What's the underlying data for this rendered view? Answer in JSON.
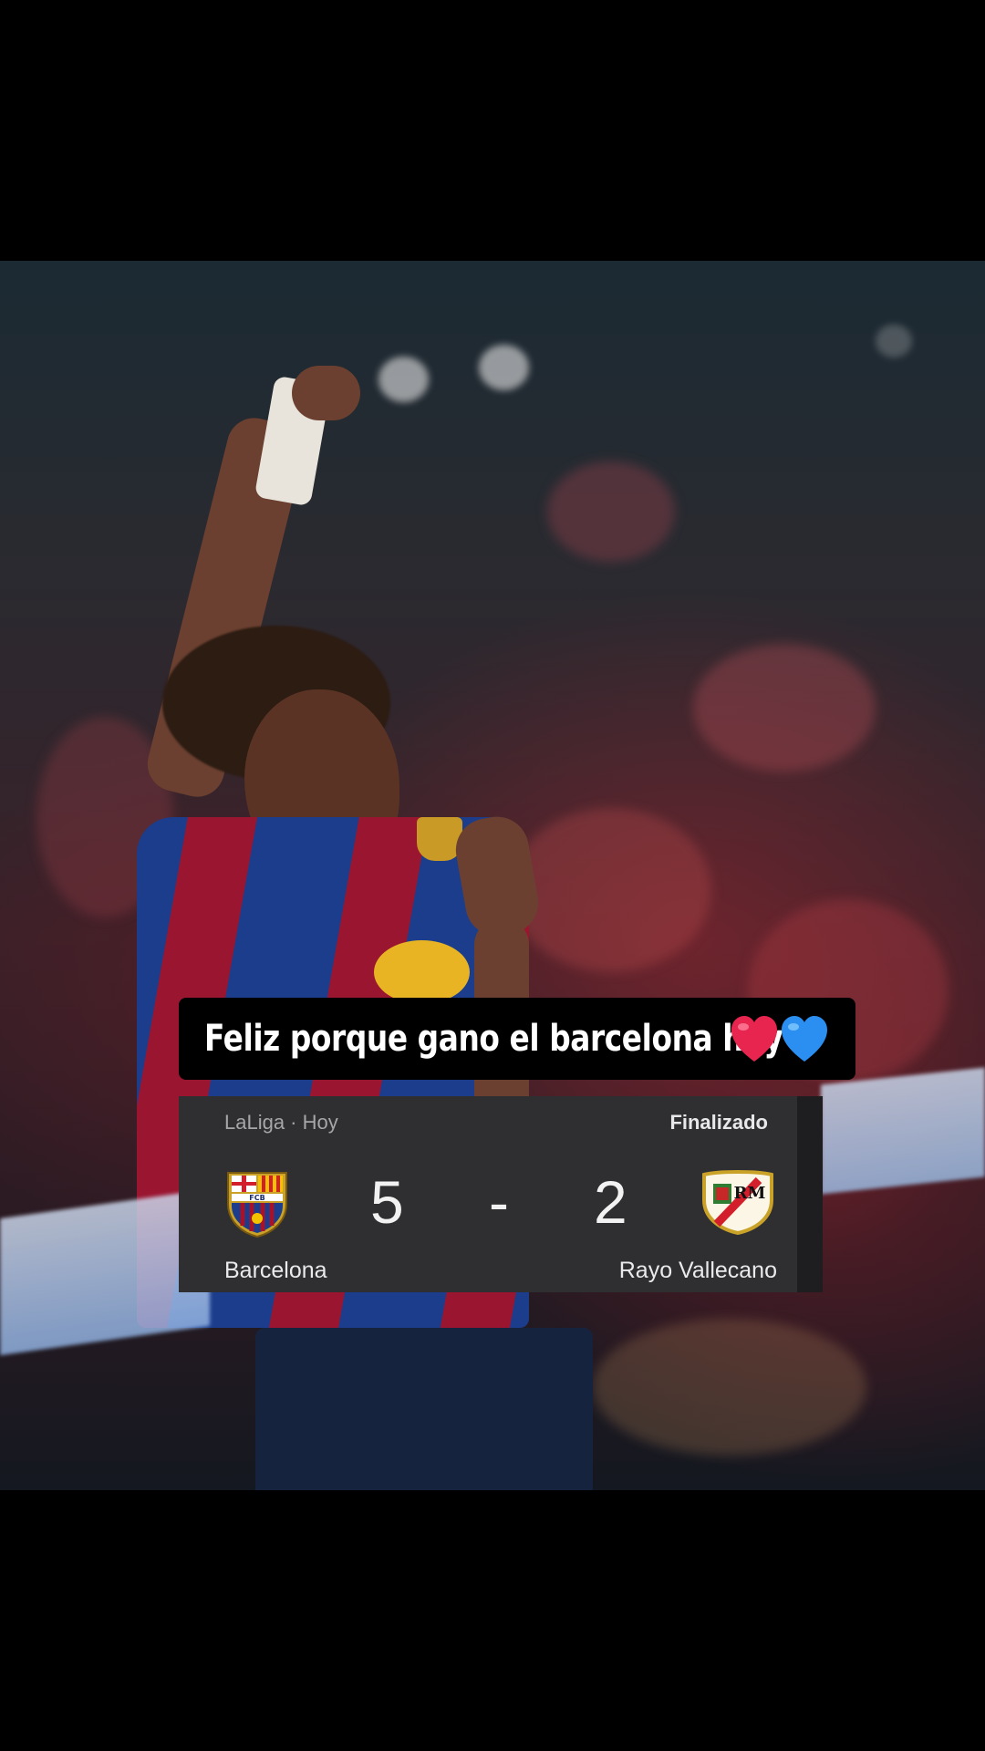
{
  "story": {
    "caption": "Feliz porque gano el barcelona hoy",
    "caption_emoji": [
      "red-heart",
      "blue-heart"
    ]
  },
  "match": {
    "league_label": "LaLiga · Hoy",
    "status": "Finalizado",
    "home": {
      "name": "Barcelona",
      "score": "5",
      "crest": "fc-barcelona-crest",
      "crest_text": "FCB"
    },
    "separator": "-",
    "away": {
      "name": "Rayo Vallecano",
      "score": "2",
      "crest": "rayo-vallecano-crest",
      "crest_text": "RM"
    }
  },
  "colors": {
    "card_bg": "#2f2f31",
    "caption_bg": "#000000",
    "heart_red": "#e8254e",
    "heart_blue": "#2a8ff0"
  }
}
